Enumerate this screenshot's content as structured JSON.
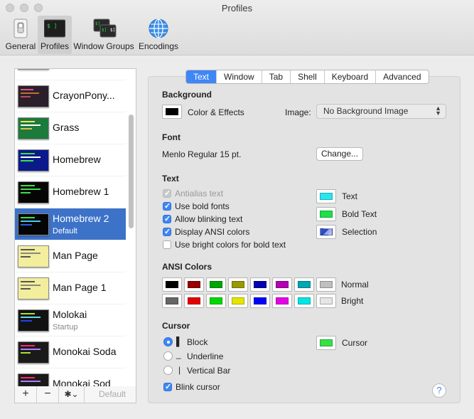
{
  "window": {
    "title": "Profiles"
  },
  "toolbar": [
    {
      "label": "General",
      "icon": "switch-icon"
    },
    {
      "label": "Profiles",
      "icon": "terminal-icon"
    },
    {
      "label": "Window Groups",
      "icon": "window-groups-icon"
    },
    {
      "label": "Encodings",
      "icon": "globe-icon"
    }
  ],
  "profiles": [
    {
      "name": "CrayonPony...",
      "sub": ""
    },
    {
      "name": "Grass",
      "sub": ""
    },
    {
      "name": "Homebrew",
      "sub": ""
    },
    {
      "name": "Homebrew 1",
      "sub": ""
    },
    {
      "name": "Homebrew 2",
      "sub": "Default"
    },
    {
      "name": "Man Page",
      "sub": ""
    },
    {
      "name": "Man Page 1",
      "sub": ""
    },
    {
      "name": "Molokai",
      "sub": "Startup"
    },
    {
      "name": "Monokai Soda",
      "sub": ""
    },
    {
      "name": "Monokai Sod",
      "sub": ""
    }
  ],
  "sidebar_footer": {
    "add": "+",
    "remove": "−",
    "gear": "✱⌄",
    "default": "Default"
  },
  "tabs": [
    "Text",
    "Window",
    "Tab",
    "Shell",
    "Keyboard",
    "Advanced"
  ],
  "active_tab": "Text",
  "background": {
    "heading": "Background",
    "color_effects": "Color & Effects",
    "image_label": "Image:",
    "image_value": "No Background Image",
    "swatch_color": "#000000"
  },
  "font": {
    "heading": "Font",
    "value": "Menlo Regular 15 pt.",
    "change": "Change..."
  },
  "text": {
    "heading": "Text",
    "options": [
      {
        "label": "Antialias text",
        "checked": true,
        "enabled": false
      },
      {
        "label": "Use bold fonts",
        "checked": true,
        "enabled": true
      },
      {
        "label": "Allow blinking text",
        "checked": true,
        "enabled": true
      },
      {
        "label": "Display ANSI colors",
        "checked": true,
        "enabled": true
      },
      {
        "label": "Use bright colors for bold text",
        "checked": false,
        "enabled": true
      }
    ],
    "colors": [
      {
        "label": "Text",
        "color": "#28e6f0"
      },
      {
        "label": "Bold Text",
        "color": "#1ee048"
      },
      {
        "label": "Selection",
        "color": "#2f4fc8"
      }
    ]
  },
  "ansi": {
    "heading": "ANSI Colors",
    "normal_label": "Normal",
    "bright_label": "Bright",
    "normal": [
      "#000000",
      "#990000",
      "#00a600",
      "#999900",
      "#0000b2",
      "#b200b2",
      "#00a6b2",
      "#bfbfbf"
    ],
    "bright": [
      "#666666",
      "#e50000",
      "#00d900",
      "#e5e500",
      "#0000ff",
      "#e500e5",
      "#00e5e5",
      "#e5e5e5"
    ]
  },
  "cursor": {
    "heading": "Cursor",
    "options": [
      {
        "glyph": "▌",
        "label": "Block",
        "selected": true
      },
      {
        "glyph": "_",
        "label": "Underline",
        "selected": false
      },
      {
        "glyph": "|",
        "label": "Vertical Bar",
        "selected": false
      }
    ],
    "color_label": "Cursor",
    "color": "#38e048",
    "blink_label": "Blink cursor",
    "blink": true
  },
  "help": "?"
}
